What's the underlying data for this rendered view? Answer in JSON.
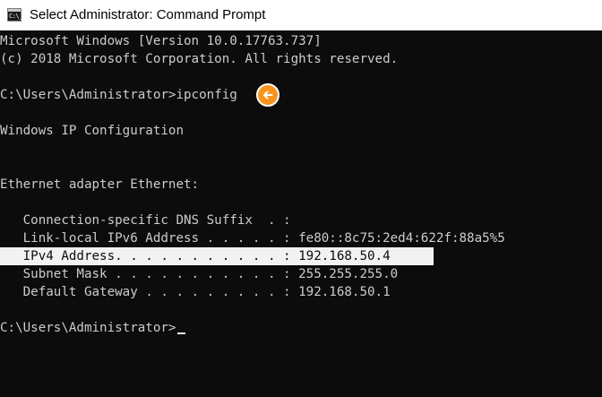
{
  "window": {
    "title": "Select Administrator: Command Prompt",
    "icon_text": "C:\\_"
  },
  "console": {
    "lines": [
      "Microsoft Windows [Version 10.0.17763.737]",
      "(c) 2018 Microsoft Corporation. All rights reserved.",
      "",
      "C:\\Users\\Administrator>ipconfig",
      "",
      "Windows IP Configuration",
      "",
      "",
      "Ethernet adapter Ethernet:",
      "",
      "   Connection-specific DNS Suffix  . :",
      "   Link-local IPv6 Address . . . . . : fe80::8c75:2ed4:622f:88a5%5",
      "   IPv4 Address. . . . . . . . . . . : 192.168.50.4",
      "   Subnet Mask . . . . . . . . . . . : 255.255.255.0",
      "   Default Gateway . . . . . . . . . : 192.168.50.1",
      "",
      "C:\\Users\\Administrator>"
    ],
    "selected_line_index": 12
  },
  "annotation": {
    "icon": "arrow-left-icon",
    "color": "#f7941d"
  },
  "colors": {
    "console_bg": "#0c0c0c",
    "console_text": "#cccccc",
    "selection_bg": "#f2f2f2"
  }
}
